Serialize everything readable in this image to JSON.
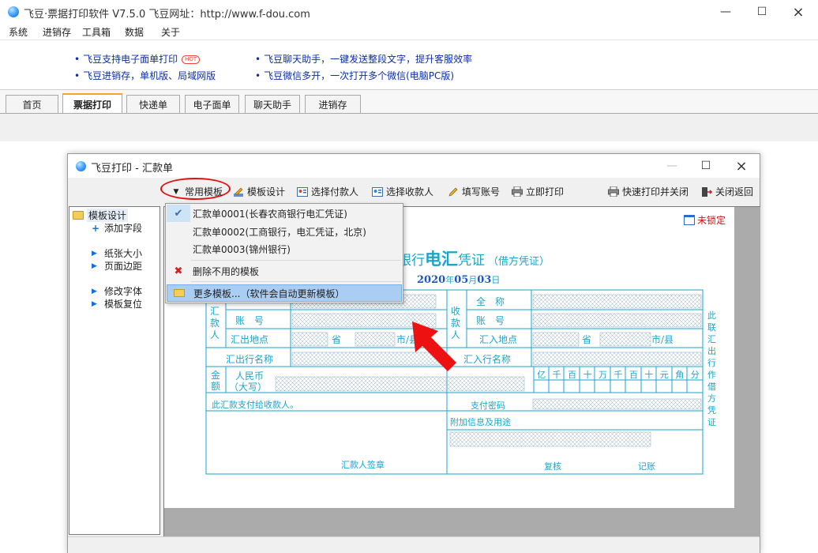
{
  "app": {
    "title": "飞豆·票据打印软件 V7.5.0   飞豆网址：http://www.f-dou.com"
  },
  "menu": [
    "系统",
    "进销存",
    "工具箱",
    "数据",
    "关于"
  ],
  "ads": [
    {
      "text": "飞豆支持电子面单打印",
      "badge": "HOT"
    },
    {
      "text": "飞豆进销存，单机版、局域网版"
    },
    {
      "text": "飞豆聊天助手，一键发送整段文字，提升客服效率"
    },
    {
      "text": "飞豆微信多开，一次打开多个微信(电脑PC版)"
    }
  ],
  "tabs": [
    "首页",
    "票据打印",
    "快递单",
    "电子面单",
    "聊天助手",
    "进销存"
  ],
  "active_tab": "票据打印",
  "dialog": {
    "title": "飞豆打印 - 汇款单",
    "toolbar": {
      "common_templates": "常用模板",
      "template_design": "模板设计",
      "select_payer": "选择付款人",
      "select_payee": "选择收款人",
      "fill_account": "填写账号",
      "print_now": "立即打印",
      "quick_print_close": "快速打印并关闭",
      "close_return": "关闭返回"
    },
    "tree": {
      "root": "模板设计",
      "items": [
        "添加字段",
        "纸张大小",
        "页面边距",
        "修改字体",
        "模板复位"
      ]
    },
    "lock_status": "未锁定",
    "form": {
      "title_a": "银行",
      "title_b": "电汇",
      "title_c": "凭证",
      "title_d": "（借方凭证）",
      "year": "2020",
      "year_unit": "年",
      "month": "05",
      "month_unit": "月",
      "day": "03",
      "day_unit": "日",
      "labels": {
        "remitter": "汇款人",
        "payee": "收款人",
        "full_name": "全　称",
        "account": "账　号",
        "account2": "账　号",
        "out_place": "汇出地点",
        "in_place": "汇入地点",
        "province": "省",
        "city": "市/县",
        "province2": "省",
        "city2": "市/县",
        "out_bank": "汇出行名称",
        "in_bank": "汇入行名称",
        "amount": "金额",
        "rmb": "人民币",
        "capital": "（大写）",
        "pay_note": "此汇款支付给收款人。",
        "pay_pwd": "支付密码",
        "extra": "附加信息及用途",
        "signature": "汇款人签章",
        "review": "复核",
        "record": "记账"
      },
      "digits": [
        "亿",
        "千",
        "百",
        "十",
        "万",
        "千",
        "百",
        "十",
        "元",
        "角",
        "分"
      ],
      "side_text": "此联汇出行作借方凭证"
    }
  },
  "dropdown": {
    "items": [
      {
        "label": "汇款单0001(长春农商银行电汇凭证)",
        "checked": true
      },
      {
        "label": "汇款单0002(工商银行，电汇凭证，北京)"
      },
      {
        "label": "汇款单0003(锦州银行)"
      }
    ],
    "delete_unused": "删除不用的模板",
    "more": "更多模板...（软件会自动更新模板）"
  },
  "colors": {
    "form_cyan": "#1aa6c9",
    "date_blue": "#1a55c9",
    "accent_tab": "#f5a623",
    "annotation_red": "#e01010"
  }
}
